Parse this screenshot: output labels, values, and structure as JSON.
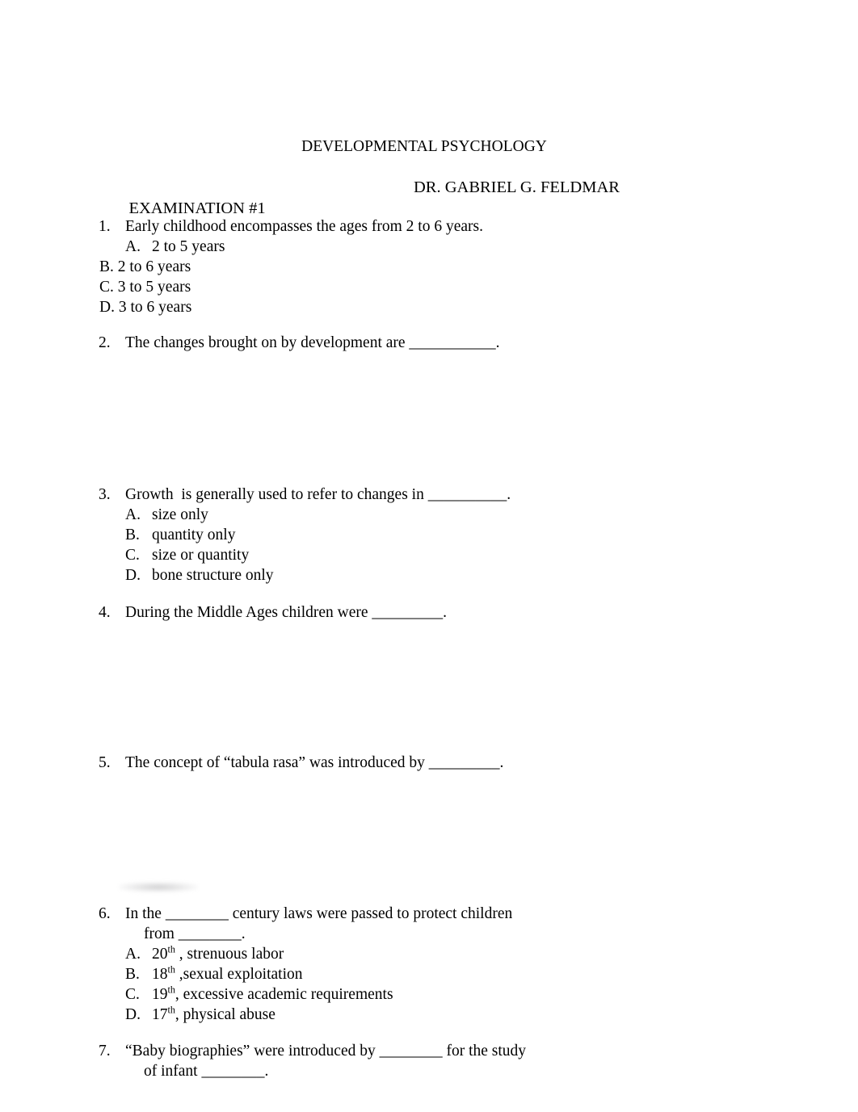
{
  "document": {
    "title": "DEVELOPMENTAL PSYCHOLOGY",
    "exam_label": "EXAMINATION #1",
    "instructor": "DR. GABRIEL G. FELDMAR"
  },
  "questions": [
    {
      "number": "1.",
      "stem": "Early childhood encompasses the ages from 2 to 6 years.",
      "options": [
        {
          "label": "A.",
          "text": "2 to 5 years"
        },
        {
          "label": "B.",
          "text": "2 to 6 years"
        },
        {
          "label": "C.",
          "text": "3 to 5 years"
        },
        {
          "label": "D.",
          "text": "3 to 6 years"
        }
      ]
    },
    {
      "number": "2.",
      "stem": "The changes brought on by development are ___________.",
      "options": []
    },
    {
      "number": "3.",
      "stem": "Growth  is generally used to refer to changes in __________.",
      "options": [
        {
          "label": "A.",
          "text": "size only"
        },
        {
          "label": "B.",
          "text": "quantity only"
        },
        {
          "label": "C.",
          "text": "size or quantity"
        },
        {
          "label": "D.",
          "text": "bone structure only"
        }
      ]
    },
    {
      "number": "4.",
      "stem": "During the Middle Ages children were _________.",
      "options": []
    },
    {
      "number": "5.",
      "stem": "The concept of “tabula rasa” was introduced by _________.",
      "options": []
    },
    {
      "number": "6.",
      "stem": "In the ________ century laws were passed to protect children",
      "stem_cont": "from ________.",
      "options": [
        {
          "label": "A.",
          "prefix": "20",
          "ordinal": "th",
          "suffix": " , strenuous labor"
        },
        {
          "label": "B.",
          "prefix": "18",
          "ordinal": "th",
          "suffix": " ,sexual exploitation"
        },
        {
          "label": "C.",
          "prefix": "19",
          "ordinal": "th",
          "suffix": ", excessive academic requirements"
        },
        {
          "label": "D.",
          "prefix": "17",
          "ordinal": "th",
          "suffix": ", physical abuse"
        }
      ]
    },
    {
      "number": "7.",
      "stem": "“Baby biographies” were introduced by ________ for the study",
      "stem_cont": "of infant ________.",
      "options": []
    }
  ]
}
